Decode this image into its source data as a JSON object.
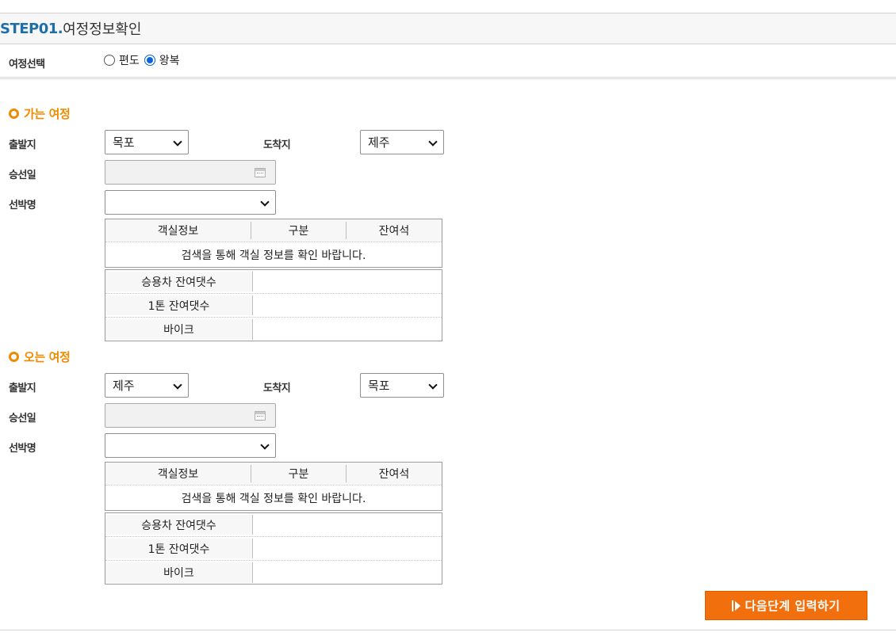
{
  "step": {
    "number": "STEP01.",
    "title": "여정정보확인"
  },
  "trip_type": {
    "label": "여정선택",
    "options": [
      {
        "label": "편도",
        "checked": false
      },
      {
        "label": "왕복",
        "checked": true
      }
    ]
  },
  "outbound": {
    "title": "가는 여정",
    "departure_label": "출발지",
    "departure_value": "목포",
    "arrival_label": "도착지",
    "arrival_value": "제주",
    "date_label": "승선일",
    "date_value": "",
    "ship_label": "선박명",
    "ship_value": "",
    "room_headers": [
      "객실정보",
      "구분",
      "잔여석"
    ],
    "room_message": "검색을 통해 객실 정보를 확인 바랍니다.",
    "vehicles": [
      {
        "label": "승용차 잔여댓수",
        "value": ""
      },
      {
        "label": "1톤 잔여댓수",
        "value": ""
      },
      {
        "label": "바이크",
        "value": ""
      }
    ]
  },
  "return": {
    "title": "오는 여정",
    "departure_label": "출발지",
    "departure_value": "제주",
    "arrival_label": "도착지",
    "arrival_value": "목포",
    "date_label": "승선일",
    "date_value": "",
    "ship_label": "선박명",
    "ship_value": "",
    "room_headers": [
      "객실정보",
      "구분",
      "잔여석"
    ],
    "room_message": "검색을 통해 객실 정보를 확인 바랍니다.",
    "vehicles": [
      {
        "label": "승용차 잔여댓수",
        "value": ""
      },
      {
        "label": "1톤 잔여댓수",
        "value": ""
      },
      {
        "label": "바이크",
        "value": ""
      }
    ]
  },
  "next_button": {
    "label": "다음단계 입력하기"
  },
  "colors": {
    "accent": "#f08a00",
    "button": "#f26f0d",
    "step": "#1e6fa8",
    "radio": "#0a64d8"
  }
}
